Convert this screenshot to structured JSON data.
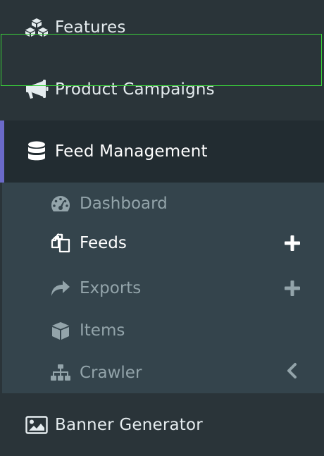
{
  "sidebar": {
    "items": [
      {
        "label": "Features",
        "icon": "cubes-icon"
      },
      {
        "label": "Product Campaigns",
        "icon": "megaphone-icon"
      },
      {
        "label": "Feed Management",
        "icon": "database-icon",
        "active": true
      },
      {
        "label": "Banner Generator",
        "icon": "image-icon"
      }
    ],
    "feed_submenu": [
      {
        "label": "Dashboard",
        "icon": "gauge-icon"
      },
      {
        "label": "Feeds",
        "icon": "copy-icon",
        "selected": true,
        "action_icon": "plus-icon"
      },
      {
        "label": "Exports",
        "icon": "share-icon",
        "action_icon": "plus-icon"
      },
      {
        "label": "Items",
        "icon": "cube-icon"
      },
      {
        "label": "Crawler",
        "icon": "sitemap-icon",
        "action_icon": "chevron-left-icon"
      }
    ]
  },
  "colors": {
    "background": "#2a3439",
    "active_background": "#222c31",
    "submenu_background": "#34444c",
    "accent_bar": "#6b6ac9",
    "selection_outline": "#3ad13a",
    "text_primary": "#e5ecef",
    "text_muted": "#93a4aa"
  }
}
